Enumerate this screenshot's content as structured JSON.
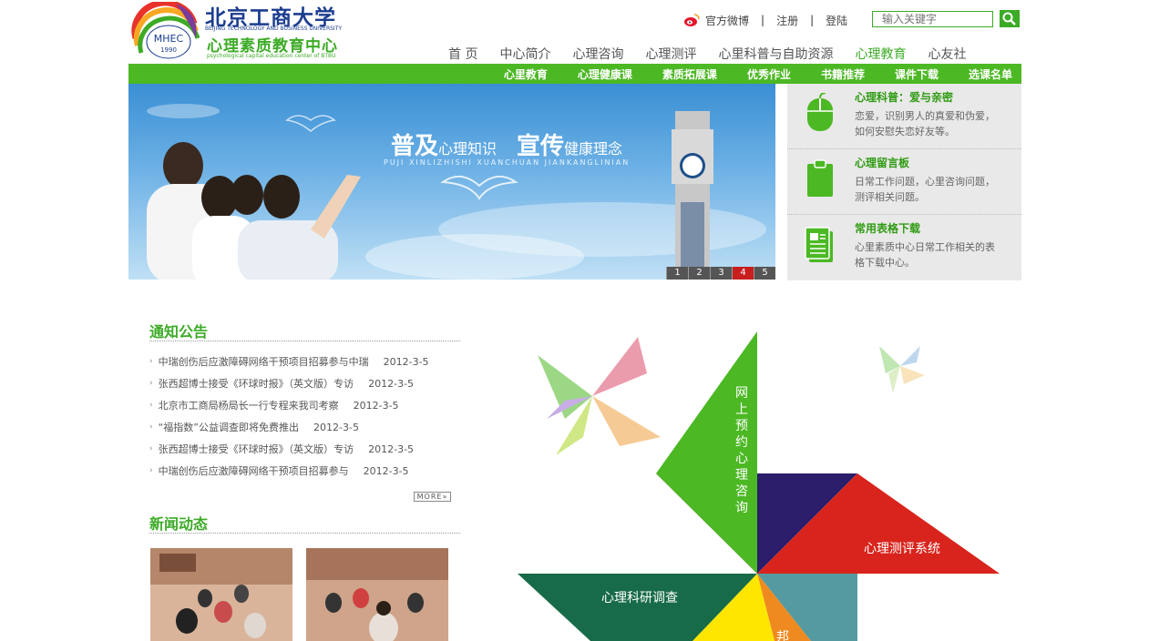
{
  "logo": {
    "badge": "MHEC",
    "year": "1990",
    "university": "北京工商大学",
    "university_en": "BEIJING TECHNOLOGY AND BUSINESS UNIVERSITY",
    "center": "心理素质教育中心",
    "center_en": "psychological capital education center of BTBU"
  },
  "toplinks": {
    "weibo": "官方微博",
    "register": "注册",
    "login": "登陆"
  },
  "search": {
    "placeholder": "输入关键字"
  },
  "mainnav": [
    "首 页",
    "中心简介",
    "心理咨询",
    "心理测评",
    "心里科普与自助资源",
    "心理教育",
    "心友社"
  ],
  "mainnav_active": 5,
  "subnav": [
    "心里教育",
    "心理健康课",
    "素质拓展课",
    "优秀作业",
    "书籍推荐",
    "课件下载",
    "选课名单"
  ],
  "banner": {
    "slogan1_big": "普及",
    "slogan1_small": "心理知识",
    "slogan2_big": "宣传",
    "slogan2_small": "健康理念",
    "pinyin": "PUJI XINLIZHISHI   XUANCHUAN JIANKANGLINIAN",
    "pages": [
      "1",
      "2",
      "3",
      "4",
      "5"
    ],
    "active_page": 4
  },
  "quick": [
    {
      "title": "心理科普：爱与亲密",
      "desc": "恋爱，识别男人的真爱和伪爱，如何安慰失恋好友等。",
      "icon": "mouse-icon"
    },
    {
      "title": "心理留言板",
      "desc": "日常工作问题，心里咨询问题，测评相关问题。",
      "icon": "clipboard-icon"
    },
    {
      "title": "常用表格下载",
      "desc": "心里素质中心日常工作相关的表格下载中心。",
      "icon": "document-icon"
    }
  ],
  "notices": {
    "title": "通知公告",
    "items": [
      {
        "text": "中瑞创伤后应激障碍网络干预项目招募参与中瑞",
        "date": "2012-3-5"
      },
      {
        "text": "张西超博士接受《环球时报》（英文版）专访",
        "date": "2012-3-5"
      },
      {
        "text": "北京市工商局杨局长一行专程来我司考察",
        "date": "2012-3-5"
      },
      {
        "text": "“福指数”公益调查即将免费推出",
        "date": "2012-3-5"
      },
      {
        "text": "张西超博士接受《环球时报》（英文版）专访",
        "date": "2012-3-5"
      },
      {
        "text": "中瑞创伤后应激障碍网络干预项目招募参与",
        "date": "2012-3-5"
      }
    ],
    "more": "MORE"
  },
  "news": {
    "title": "新闻动态"
  },
  "pinwheel": {
    "booking": "网上预约心理咨询",
    "assessment": "心理测评系统",
    "research": "心理科研调查",
    "partial": "邦"
  },
  "colors": {
    "brand_green": "#4cb824",
    "active_page": "#c81e1e"
  }
}
